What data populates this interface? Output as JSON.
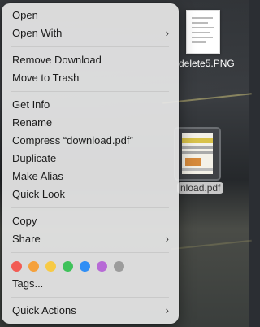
{
  "desktop": {
    "files": [
      {
        "label": "delete5.PNG"
      },
      {
        "label": "nload.pdf"
      }
    ]
  },
  "menu": {
    "group1": [
      {
        "label": "Open",
        "submenu": false
      },
      {
        "label": "Open With",
        "submenu": true
      }
    ],
    "group2": [
      {
        "label": "Remove Download"
      },
      {
        "label": "Move to Trash"
      }
    ],
    "group3": [
      {
        "label": "Get Info"
      },
      {
        "label": "Rename"
      },
      {
        "label": "Compress “download.pdf”"
      },
      {
        "label": "Duplicate"
      },
      {
        "label": "Make Alias"
      },
      {
        "label": "Quick Look"
      }
    ],
    "group4": [
      {
        "label": "Copy",
        "submenu": false
      },
      {
        "label": "Share",
        "submenu": true
      }
    ],
    "tag_colors": [
      {
        "name": "red",
        "color": "#f25c54"
      },
      {
        "name": "orange",
        "color": "#f5a13c"
      },
      {
        "name": "yellow",
        "color": "#f7ca45"
      },
      {
        "name": "green",
        "color": "#3fc25a"
      },
      {
        "name": "blue",
        "color": "#2f8ef5"
      },
      {
        "name": "purple",
        "color": "#b76ad6"
      },
      {
        "name": "gray",
        "color": "#9c9c9c"
      }
    ],
    "tags_label": "Tags...",
    "quick_actions_label": "Quick Actions",
    "chevron": "›"
  }
}
